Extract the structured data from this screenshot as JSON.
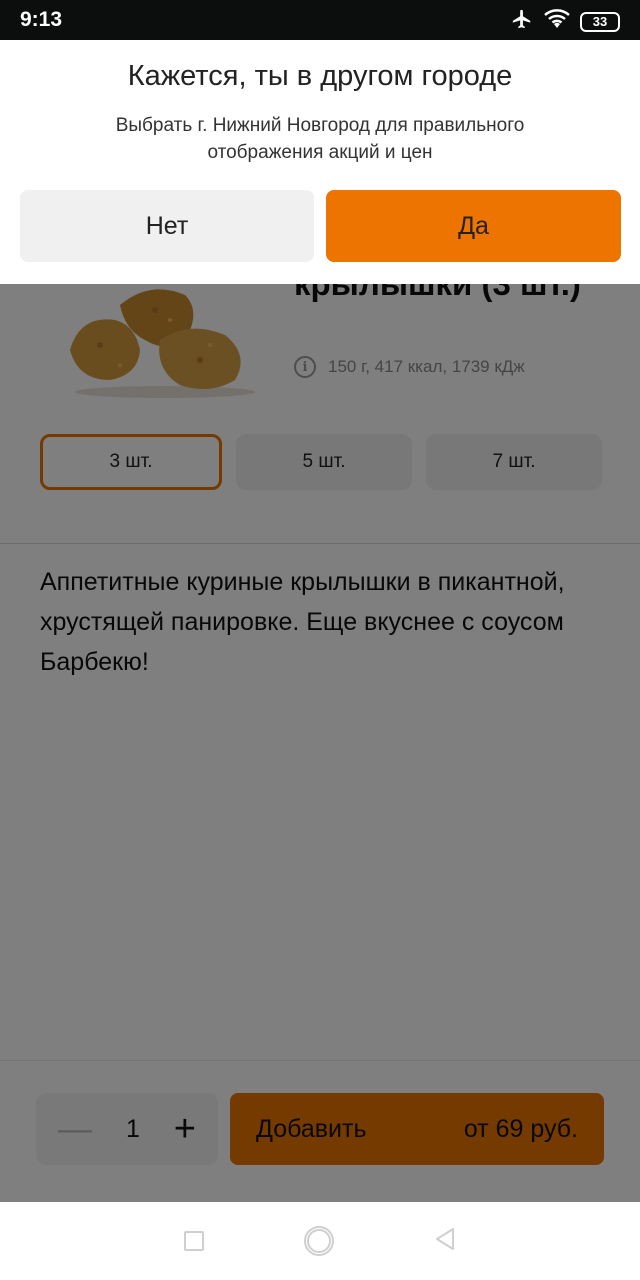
{
  "status_bar": {
    "time": "9:13",
    "battery": "33",
    "icons": [
      "airplane-icon",
      "wifi-icon",
      "battery-icon"
    ]
  },
  "dialog": {
    "title": "Кажется, ты в другом городе",
    "message": "Выбрать г. Нижний Новгород для правильного отображения акций и цен",
    "no_label": "Нет",
    "yes_label": "Да"
  },
  "product": {
    "title": "крылышки (3 шт.)",
    "nutrition": "150 г, 417 ккал, 1739 кДж",
    "sizes": [
      {
        "label": "3 шт.",
        "selected": true
      },
      {
        "label": "5 шт.",
        "selected": false
      },
      {
        "label": "7 шт.",
        "selected": false
      }
    ],
    "description": "Аппетитные куриные крылышки в пикантной, хрустящей панировке. Еще вкуснее с соусом Барбекю!"
  },
  "order": {
    "quantity": "1",
    "add_label": "Добавить",
    "price_label": "от 69 руб."
  },
  "colors": {
    "accent": "#e97400",
    "dim_overlay": "rgba(0,0,0,0.5)"
  }
}
